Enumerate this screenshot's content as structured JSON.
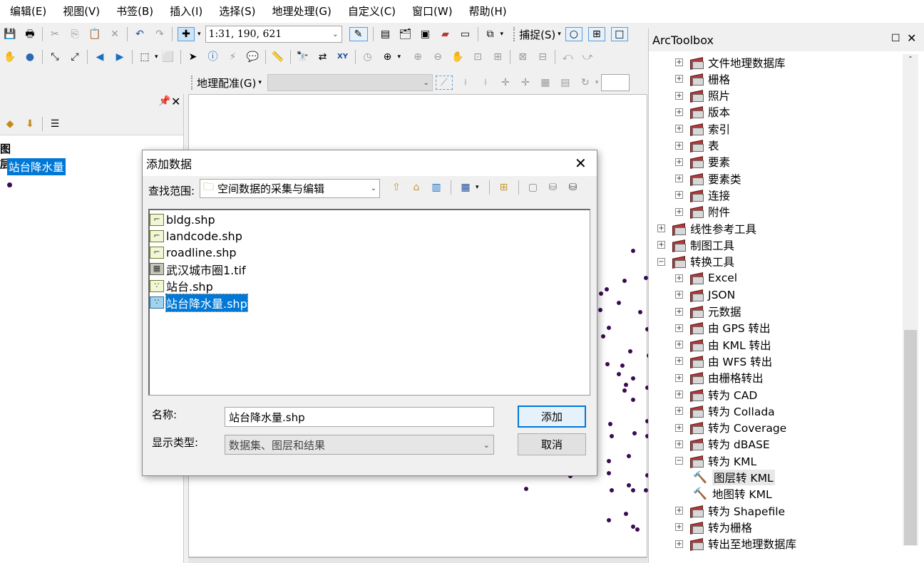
{
  "menu": [
    "编辑(E)",
    "视图(V)",
    "书签(B)",
    "插入(I)",
    "选择(S)",
    "地理处理(G)",
    "自定义(C)",
    "窗口(W)",
    "帮助(H)"
  ],
  "toolbar": {
    "scale": "1:31, 190, 621",
    "snapping_label": "捕捉(S)",
    "georef_label": "地理配准(G)"
  },
  "toc": {
    "pin": "ꟷ",
    "layers_label": "图层",
    "layer_name": "站台降水量"
  },
  "toolbox": {
    "title": "ArcToolbox",
    "items": [
      {
        "label": "文件地理数据库",
        "level": 1,
        "expand": "+"
      },
      {
        "label": "栅格",
        "level": 1,
        "expand": "+"
      },
      {
        "label": "照片",
        "level": 1,
        "expand": "+"
      },
      {
        "label": "版本",
        "level": 1,
        "expand": "+"
      },
      {
        "label": "索引",
        "level": 1,
        "expand": "+"
      },
      {
        "label": "表",
        "level": 1,
        "expand": "+"
      },
      {
        "label": "要素",
        "level": 1,
        "expand": "+"
      },
      {
        "label": "要素类",
        "level": 1,
        "expand": "+"
      },
      {
        "label": "连接",
        "level": 1,
        "expand": "+"
      },
      {
        "label": "附件",
        "level": 1,
        "expand": "+"
      },
      {
        "label": "线性参考工具",
        "level": 0,
        "expand": "+"
      },
      {
        "label": "制图工具",
        "level": 0,
        "expand": "+"
      },
      {
        "label": "转换工具",
        "level": 0,
        "expand": "−"
      },
      {
        "label": "Excel",
        "level": 1,
        "expand": "+"
      },
      {
        "label": "JSON",
        "level": 1,
        "expand": "+"
      },
      {
        "label": "元数据",
        "level": 1,
        "expand": "+"
      },
      {
        "label": "由 GPS 转出",
        "level": 1,
        "expand": "+"
      },
      {
        "label": "由 KML 转出",
        "level": 1,
        "expand": "+"
      },
      {
        "label": "由 WFS 转出",
        "level": 1,
        "expand": "+"
      },
      {
        "label": "由栅格转出",
        "level": 1,
        "expand": "+"
      },
      {
        "label": "转为 CAD",
        "level": 1,
        "expand": "+"
      },
      {
        "label": "转为 Collada",
        "level": 1,
        "expand": "+"
      },
      {
        "label": "转为 Coverage",
        "level": 1,
        "expand": "+"
      },
      {
        "label": "转为 dBASE",
        "level": 1,
        "expand": "+"
      },
      {
        "label": "转为 KML",
        "level": 1,
        "expand": "−"
      },
      {
        "label": "图层转 KML",
        "level": 2,
        "expand": ""
      },
      {
        "label": "地图转 KML",
        "level": 2,
        "expand": ""
      },
      {
        "label": "转为 Shapefile",
        "level": 1,
        "expand": "+"
      },
      {
        "label": "转为栅格",
        "level": 1,
        "expand": "+"
      },
      {
        "label": "转出至地理数据库",
        "level": 1,
        "expand": "+"
      }
    ]
  },
  "dialog": {
    "title": "添加数据",
    "lookin_label": "查找范围:",
    "lookin_value": "空间数据的采集与编辑",
    "files": [
      {
        "name": "bldg.shp",
        "icon": "polyline",
        "selected": false
      },
      {
        "name": "landcode.shp",
        "icon": "polyline",
        "selected": false
      },
      {
        "name": "roadline.shp",
        "icon": "polyline",
        "selected": false
      },
      {
        "name": "武汉城市圈1.tif",
        "icon": "raster",
        "selected": false
      },
      {
        "name": "站台.shp",
        "icon": "point",
        "selected": false
      },
      {
        "name": "站台降水量.shp",
        "icon": "point",
        "selected": true
      }
    ],
    "name_label": "名称:",
    "name_value": "站台降水量.shp",
    "type_label": "显示类型:",
    "type_value": "数据集、图层和结果",
    "add_button": "添加",
    "cancel_button": "取消"
  },
  "colors": {
    "selection": "#0078d7",
    "point": "#3b0a52",
    "toolbox_icon": "#b43a3a"
  }
}
